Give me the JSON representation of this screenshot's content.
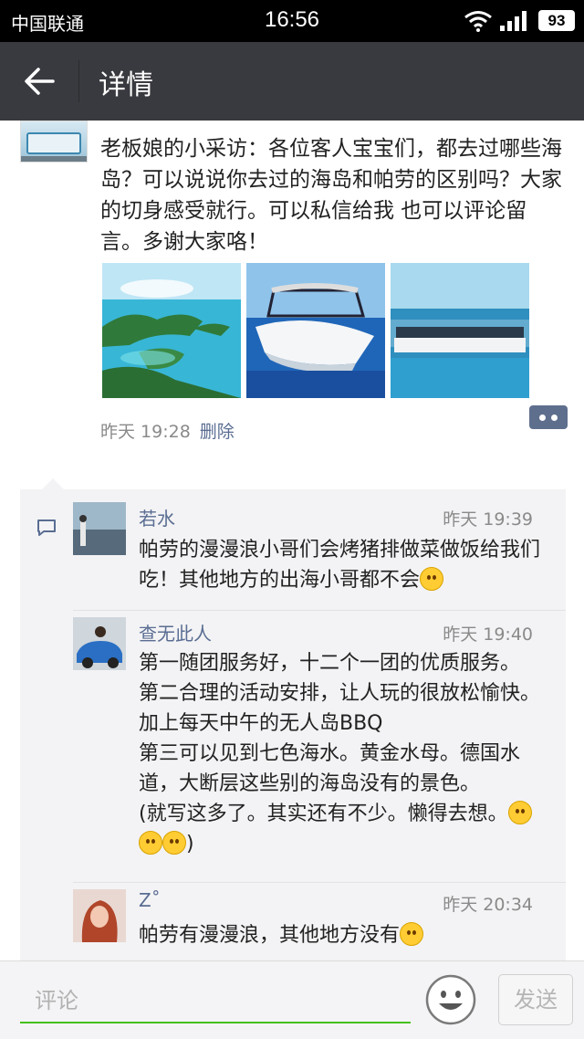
{
  "status_bar": {
    "carrier": "中国联通",
    "time": "16:56",
    "battery": "93"
  },
  "header": {
    "title": "详情"
  },
  "post": {
    "text": "老板娘的小采访：各位客人宝宝们，都去过哪些海岛？可以说说你去过的海岛和帕劳的区别吗？大家的切身感受就行。可以私信给我 也可以评论留言。多谢大家咯！",
    "time": "昨天 19:28",
    "delete_label": "删除"
  },
  "comments": [
    {
      "name": "若水",
      "time": "昨天 19:39",
      "text": "帕劳的漫漫浪小哥们会烤猪排做菜做饭给我们吃！其他地方的出海小哥都不会"
    },
    {
      "name": "查无此人",
      "time": "昨天 19:40",
      "lines": [
        "第一随团服务好，十二个一团的优质服务。",
        "第二合理的活动安排，让人玩的很放松愉快。加上每天中午的无人岛BBQ",
        "第三可以见到七色海水。黄金水母。德国水道，大断层这些别的海岛没有的景色。",
        "(就写这多了。其实还有不少。懒得去想。"
      ],
      "tail": ")"
    },
    {
      "name": "Z˚",
      "time": "昨天 20:34",
      "text": "帕劳有漫漫浪，其他地方没有"
    }
  ],
  "input": {
    "placeholder": "评论",
    "send_label": "发送"
  },
  "colors": {
    "accent": "#45c01a",
    "name": "#5a6d92",
    "titlebar": "#393a3f"
  },
  "icons": [
    "wifi-icon",
    "signal-icon",
    "back-arrow-icon",
    "more-icon",
    "comment-icon",
    "emoji-icon"
  ]
}
